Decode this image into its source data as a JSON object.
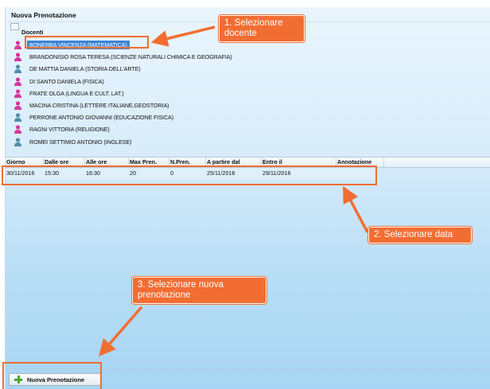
{
  "window": {
    "title": "Nuova Prenotazione"
  },
  "tree": {
    "root_label": "Docenti",
    "teachers": [
      {
        "name": "BONERBA VINCENZA (MATEMATICA)",
        "gender": "female",
        "selected": true
      },
      {
        "name": "BRANDONISIO ROSA TERESA (SCIENZE NATURALI CHIMICA E GEOGRAFIA)",
        "gender": "female",
        "selected": false
      },
      {
        "name": "DE MATTIA DANIELA (STORIA DELL'ARTE)",
        "gender": "male",
        "selected": false
      },
      {
        "name": "DI SANTO DANIELA (FISICA)",
        "gender": "female",
        "selected": false
      },
      {
        "name": "FRATE OLGA (LINGUA E CULT. LAT.)",
        "gender": "female",
        "selected": false
      },
      {
        "name": "MACINA CRISTINA (LETTERE ITALIANE,GEOSTORIA)",
        "gender": "female",
        "selected": false
      },
      {
        "name": "PERRONE ANTONIO GIOVANNI (EDUCAZIONE FISICA)",
        "gender": "male",
        "selected": false
      },
      {
        "name": "RAGNI VITTORIA (RELIGIONE)",
        "gender": "female",
        "selected": false
      },
      {
        "name": "ROMEI SETTIMIO ANTONIO (INGLESE)",
        "gender": "male",
        "selected": false
      }
    ]
  },
  "grid": {
    "columns": [
      "Giorno",
      "Dalle ore",
      "Alle ore",
      "Max Pren.",
      "N.Pren.",
      "A partire dal",
      "Entro il",
      "Annotazione"
    ],
    "rows": [
      [
        "30/11/2016",
        "15:30",
        "16:30",
        "20",
        "0",
        "25/11/2016",
        "29/11/2016",
        ""
      ]
    ]
  },
  "button": {
    "label": "Nuova Prenotazione"
  },
  "annotations": {
    "step1": "1. Selezionare docente",
    "step2": "2. Selezionare data",
    "step3": "3. Selezionare nuova prenotazione"
  },
  "colors": {
    "accent": "#f26d32",
    "selection": "#3b84d8",
    "female_icon": "#d6379b",
    "male_icon": "#4f8fa3"
  }
}
